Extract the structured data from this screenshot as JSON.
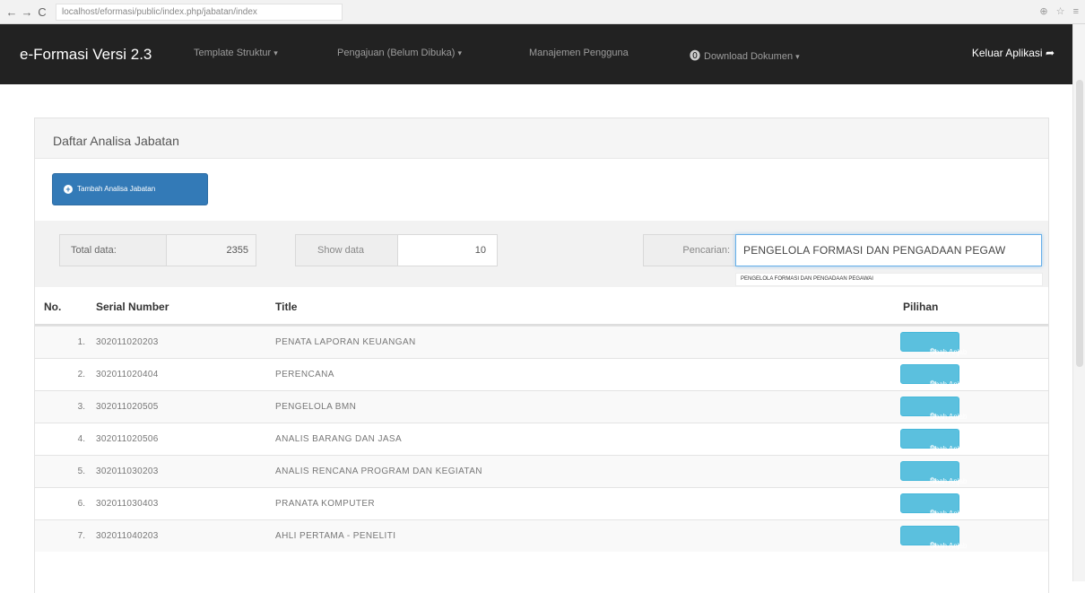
{
  "browser": {
    "nav": [
      "←",
      "→",
      "C"
    ],
    "url": "localhost/eformasi/public/index.php/jabatan/index",
    "right_icons": "⊕ ☆ ≡"
  },
  "navbar": {
    "brand": "e-Formasi Versi 2.3",
    "menu": [
      "Template Struktur",
      "Pengajuan (Belum Dibuka)",
      "Manajemen Pengguna",
      "Download Dokumen"
    ],
    "logout": "Keluar Aplikasi"
  },
  "panel": {
    "heading": "Daftar Analisa Jabatan",
    "add_button": "Tambah Analisa Jabatan"
  },
  "filters": {
    "total_label": "Total data:",
    "total_value": "2355",
    "show_label": "Show data",
    "show_value": "10",
    "search_label": "Pencarian:",
    "search_value": "PENGELOLA FORMASI DAN PENGADAAN PEGAW",
    "suggestion": "PENGELOLA FORMASI DAN PENGADAAN PEGAWAI"
  },
  "table": {
    "headers": {
      "no": "No.",
      "serial": "Serial Number",
      "title": "Title",
      "pilihan": "Pilihan"
    },
    "edit_label": "Ubah Anjab",
    "rows": [
      {
        "no": "1.",
        "serial": "302011020203",
        "title": "PENATA LAPORAN KEUANGAN"
      },
      {
        "no": "2.",
        "serial": "302011020404",
        "title": "PERENCANA"
      },
      {
        "no": "3.",
        "serial": "302011020505",
        "title": "PENGELOLA BMN"
      },
      {
        "no": "4.",
        "serial": "302011020506",
        "title": "ANALIS BARANG DAN JASA"
      },
      {
        "no": "5.",
        "serial": "302011030203",
        "title": "ANALIS RENCANA PROGRAM DAN KEGIATAN"
      },
      {
        "no": "6.",
        "serial": "302011030403",
        "title": "PRANATA KOMPUTER"
      },
      {
        "no": "7.",
        "serial": "302011040203",
        "title": "AHLI PERTAMA - PENELITI"
      }
    ]
  }
}
